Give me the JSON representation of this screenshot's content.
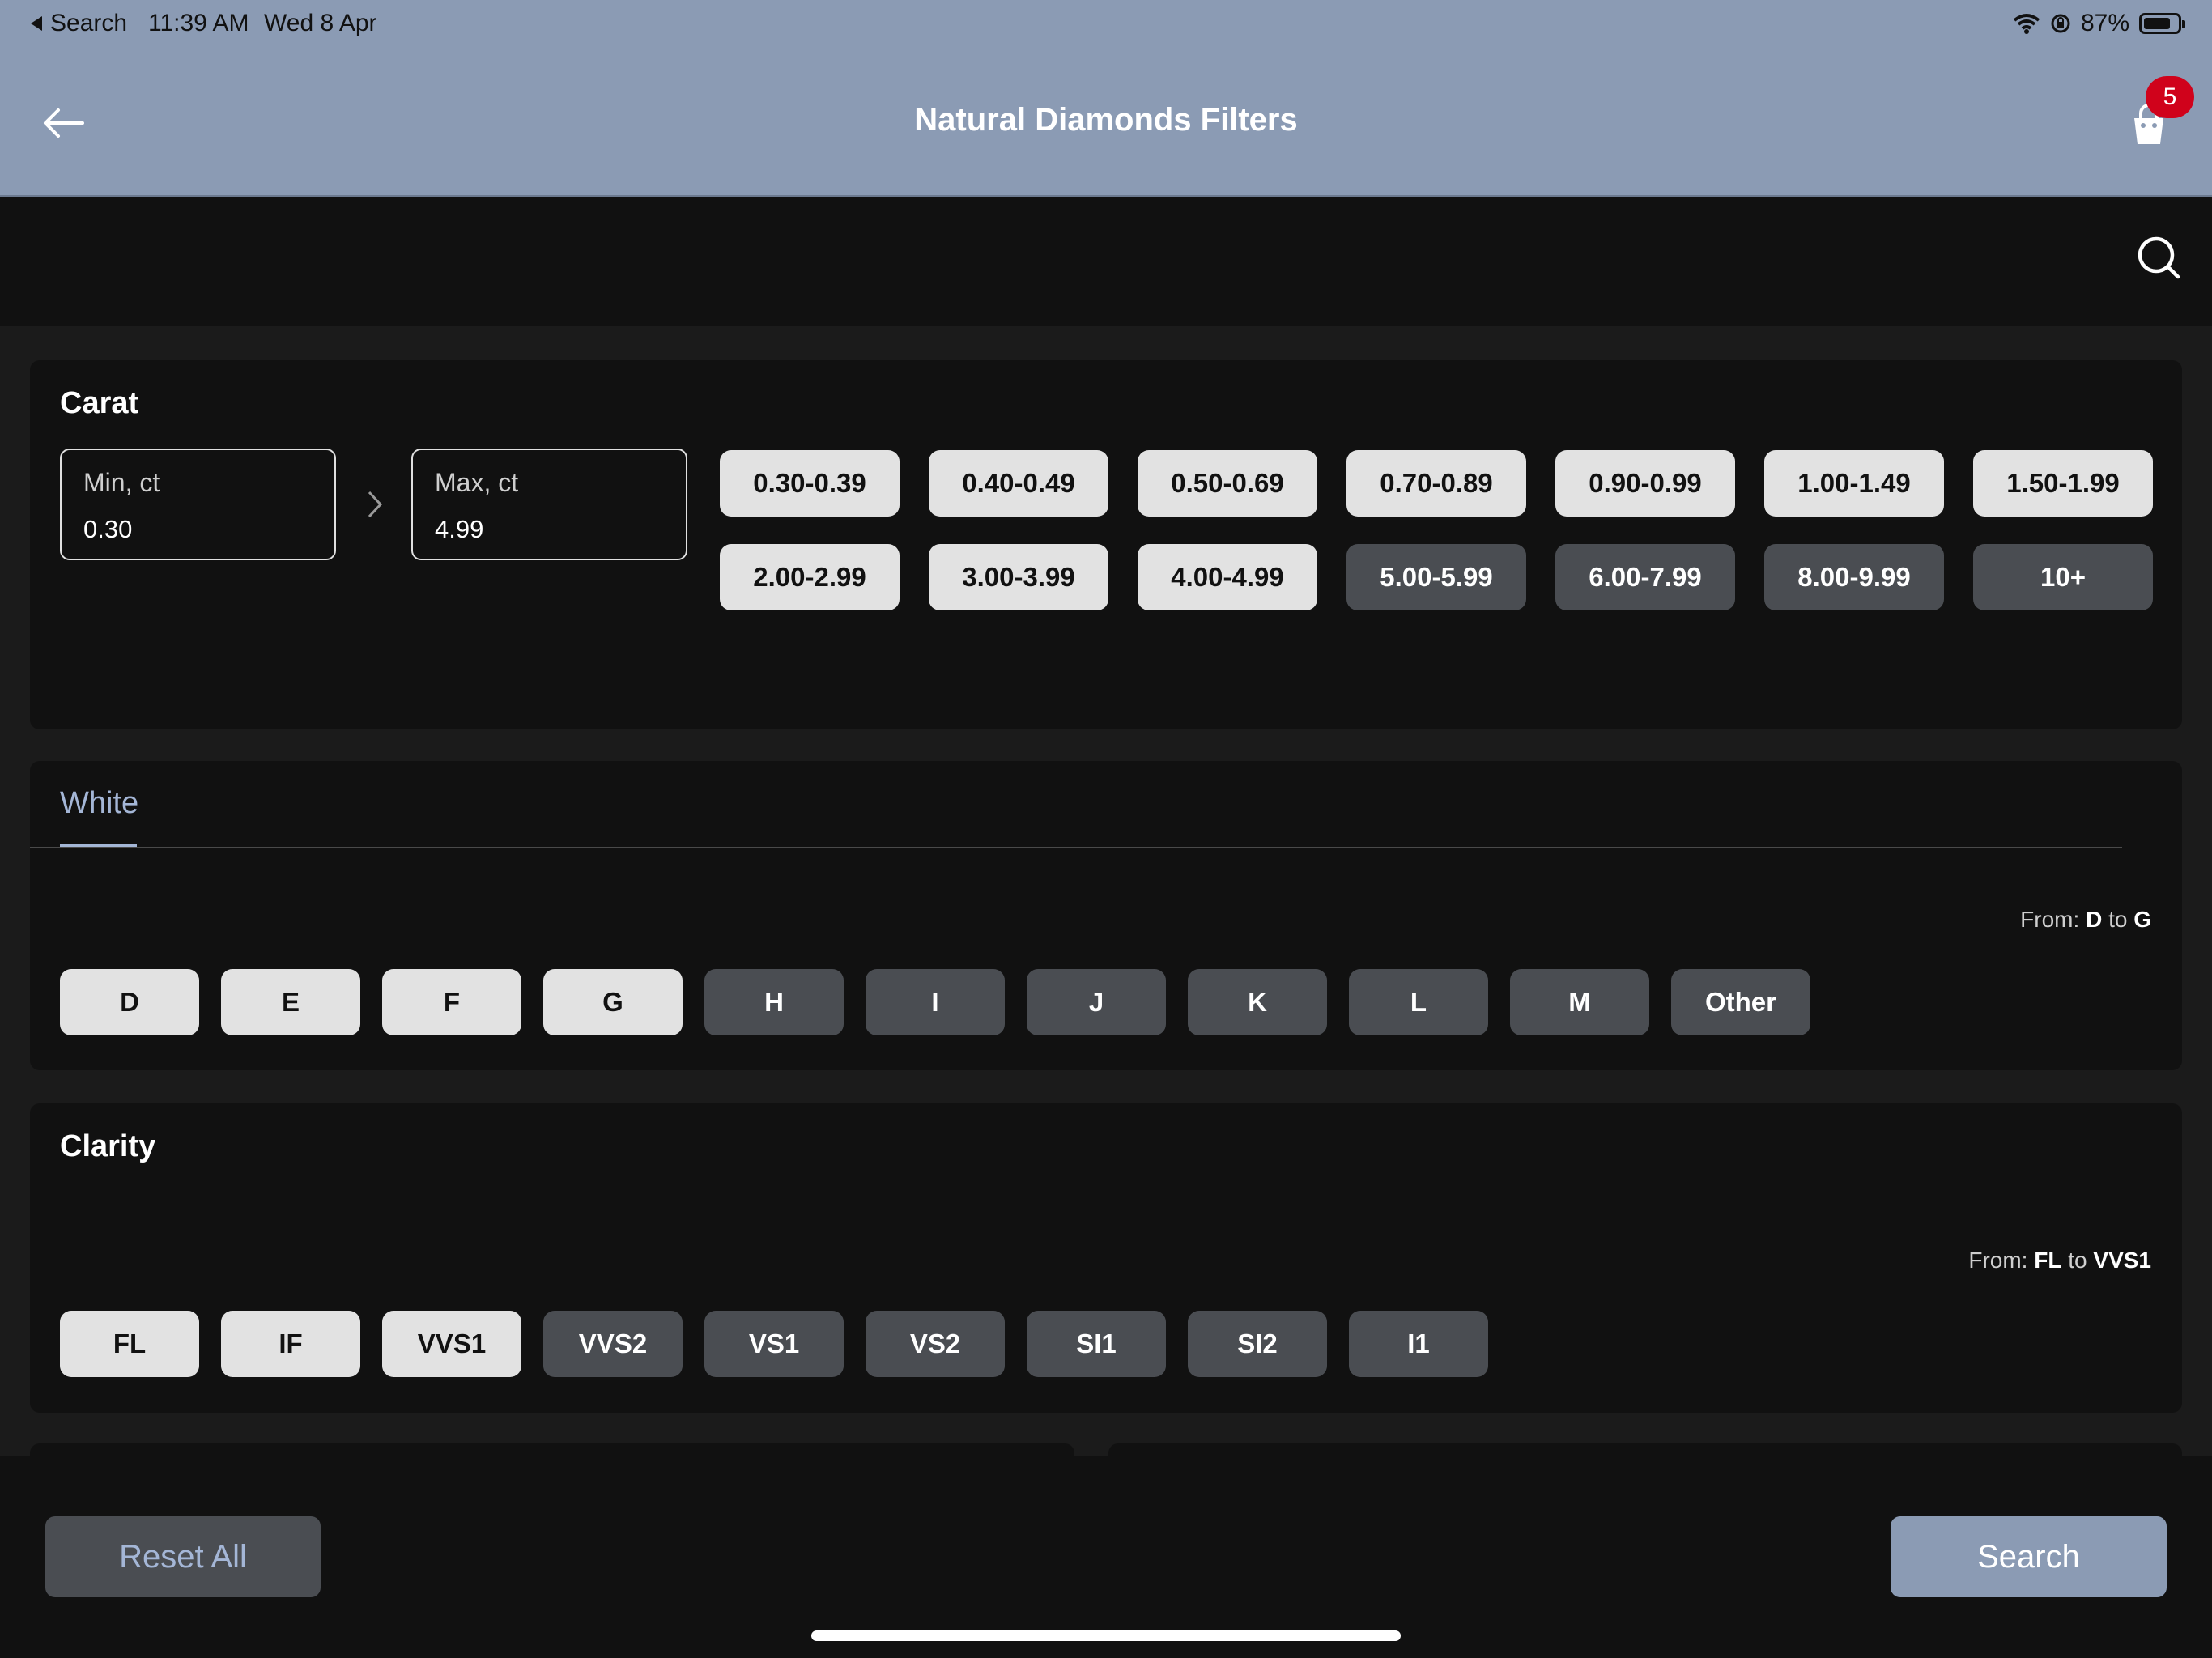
{
  "status_bar": {
    "back_app": "Search",
    "time": "11:39 AM",
    "date": "Wed 8 Apr",
    "battery": "87%"
  },
  "header": {
    "title": "Natural Diamonds Filters",
    "cart_count": "5"
  },
  "carat": {
    "title": "Carat",
    "min": {
      "label": "Min, ct",
      "value": "0.30"
    },
    "max": {
      "label": "Max, ct",
      "value": "4.99"
    },
    "ranges": [
      {
        "label": "0.30-0.39",
        "selected": true
      },
      {
        "label": "0.40-0.49",
        "selected": true
      },
      {
        "label": "0.50-0.69",
        "selected": true
      },
      {
        "label": "0.70-0.89",
        "selected": true
      },
      {
        "label": "0.90-0.99",
        "selected": true
      },
      {
        "label": "1.00-1.49",
        "selected": true
      },
      {
        "label": "1.50-1.99",
        "selected": true
      },
      {
        "label": "2.00-2.99",
        "selected": true
      },
      {
        "label": "3.00-3.99",
        "selected": true
      },
      {
        "label": "4.00-4.99",
        "selected": true
      },
      {
        "label": "5.00-5.99",
        "selected": false
      },
      {
        "label": "6.00-7.99",
        "selected": false
      },
      {
        "label": "8.00-9.99",
        "selected": false
      },
      {
        "label": "10+",
        "selected": false
      }
    ]
  },
  "color": {
    "tab": "White",
    "from_prefix": "From:",
    "from": "D",
    "to_word": "to",
    "to": "G",
    "grades": [
      {
        "label": "D",
        "selected": true
      },
      {
        "label": "E",
        "selected": true
      },
      {
        "label": "F",
        "selected": true
      },
      {
        "label": "G",
        "selected": true
      },
      {
        "label": "H",
        "selected": false
      },
      {
        "label": "I",
        "selected": false
      },
      {
        "label": "J",
        "selected": false
      },
      {
        "label": "K",
        "selected": false
      },
      {
        "label": "L",
        "selected": false
      },
      {
        "label": "M",
        "selected": false
      },
      {
        "label": "Other",
        "selected": false
      }
    ]
  },
  "clarity": {
    "title": "Clarity",
    "from_prefix": "From:",
    "from": "FL",
    "to_word": "to",
    "to": "VVS1",
    "grades": [
      {
        "label": "FL",
        "selected": true
      },
      {
        "label": "IF",
        "selected": true
      },
      {
        "label": "VVS1",
        "selected": true
      },
      {
        "label": "VVS2",
        "selected": false
      },
      {
        "label": "VS1",
        "selected": false
      },
      {
        "label": "VS2",
        "selected": false
      },
      {
        "label": "SI1",
        "selected": false
      },
      {
        "label": "SI2",
        "selected": false
      },
      {
        "label": "I1",
        "selected": false
      }
    ]
  },
  "footer": {
    "reset_label": "Reset All",
    "search_label": "Search"
  },
  "colors": {
    "header_bg": "#8b9bb4",
    "chip_selected": "#e2e2e2",
    "chip_unselected": "#4a4d52",
    "accent": "#a4b6d6",
    "badge": "#d0021b"
  }
}
